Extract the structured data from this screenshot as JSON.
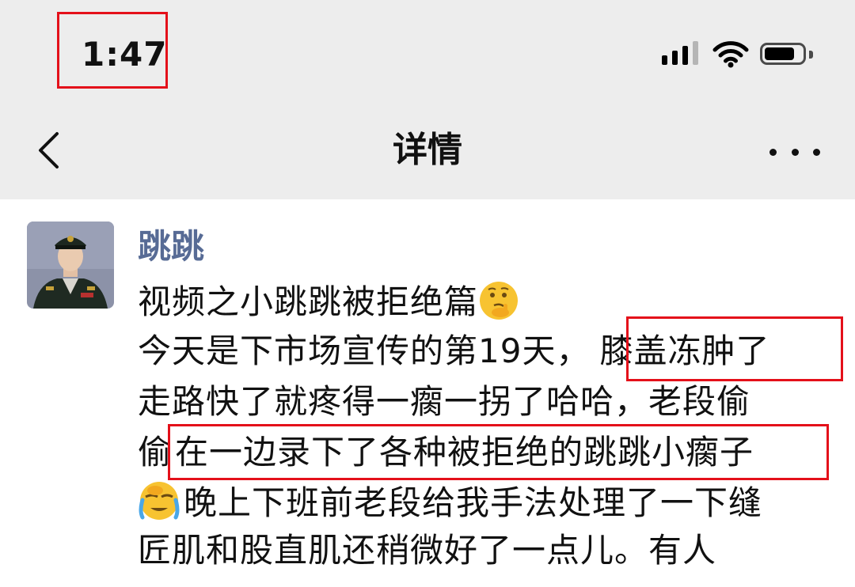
{
  "status_bar": {
    "time": "1:47",
    "signal_bars_filled": 3,
    "signal_bars_total": 4,
    "battery_level": 0.8
  },
  "nav": {
    "title": "详情",
    "back_icon": "chevron-left-icon",
    "more_icon": "more-dots-icon"
  },
  "post": {
    "author": "跳跳",
    "lines": [
      "视频之小跳跳被拒绝篇",
      "今天是下市场宣传的第19天，",
      "膝盖冻肿了",
      "走路快了就疼得一瘸一拐了哈哈，老段偷",
      "偷",
      "在一边录下了各种被拒绝的跳跳小瘸子",
      "晚上下班前老段给我手法处理了一下缝",
      "匠肌和股直肌还稍微好了一点儿。有人"
    ],
    "emojis": [
      "thinking-face-emoji",
      "face-palm-crying-emoji"
    ]
  },
  "colors": {
    "nav_bg": "#ededed",
    "author": "#576b95",
    "highlight_box": "#e4101a"
  }
}
